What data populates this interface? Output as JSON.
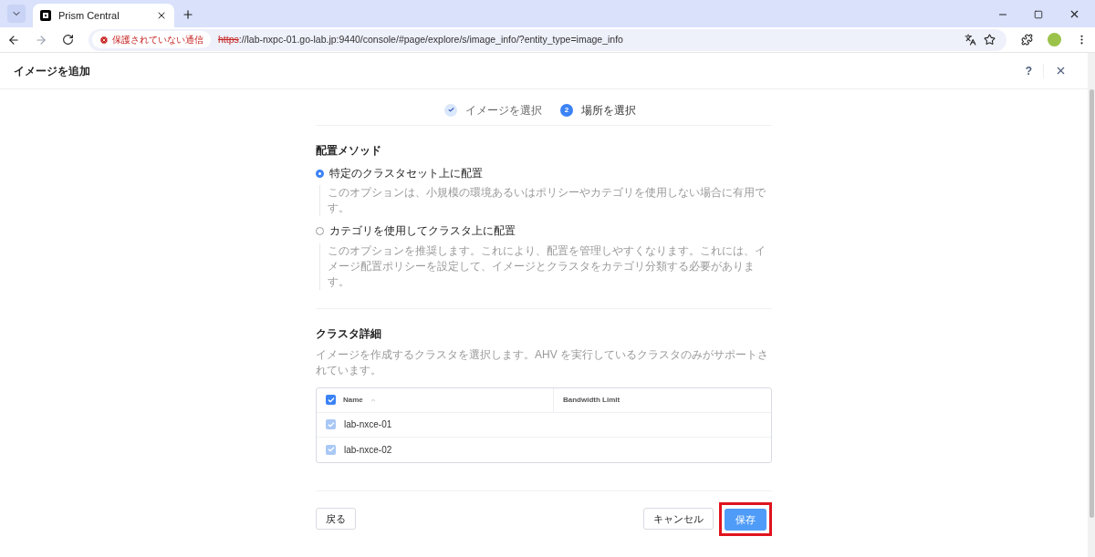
{
  "browser": {
    "tab": {
      "title": "Prism Central"
    },
    "security_label": "保護されていない通信",
    "url_scheme": "https",
    "url_rest": "://lab-nxpc-01.go-lab.jp:9440/console/#page/explore/s/image_info/?entity_type=image_info"
  },
  "dialog": {
    "title": "イメージを追加",
    "help": "?"
  },
  "steps": [
    {
      "label": "イメージを選択",
      "completed": true
    },
    {
      "label": "場所を選択",
      "number": "2",
      "completed": false
    }
  ],
  "placement": {
    "heading": "配置メソッド",
    "options": [
      {
        "label": "特定のクラスタセット上に配置",
        "description": "このオプションは、小規模の環境あるいはポリシーやカテゴリを使用しない場合に有用です。",
        "selected": true
      },
      {
        "label": "カテゴリを使用してクラスタ上に配置",
        "description": "このオプションを推奨します。これにより、配置を管理しやすくなります。これには、イメージ配置ポリシーを設定して、イメージとクラスタをカテゴリ分類する必要があります。",
        "selected": false
      }
    ]
  },
  "clusters": {
    "heading": "クラスタ詳細",
    "description": "イメージを作成するクラスタを選択します。AHV を実行しているクラスタのみがサポートされています。",
    "table": {
      "select_all_checked": true,
      "columns": [
        "Name",
        "Bandwidth Limit"
      ],
      "rows": [
        {
          "name": "lab-nxce-01",
          "checked": true
        },
        {
          "name": "lab-nxce-02",
          "checked": true
        }
      ]
    }
  },
  "footer": {
    "back": "戻る",
    "cancel": "キャンセル",
    "save": {
      "label": "保存",
      "highlighted": true
    }
  }
}
